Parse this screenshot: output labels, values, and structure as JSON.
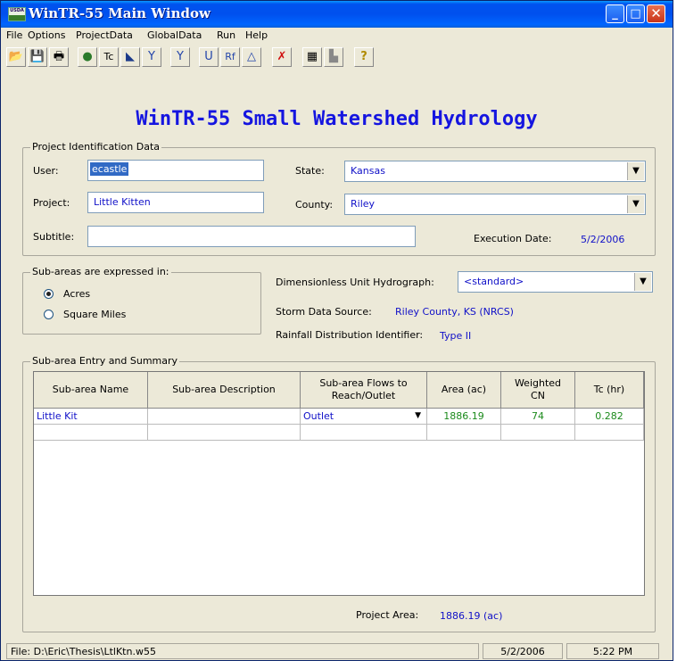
{
  "window": {
    "title": "WinTR-55 Main Window",
    "icon_label": "USDA",
    "minimize_glyph": "_",
    "maximize_glyph": "□",
    "close_glyph": "✕"
  },
  "menu": [
    "File",
    "Options",
    "ProjectData",
    "GlobalData",
    "Run",
    "Help"
  ],
  "toolbar": [
    {
      "name": "open-icon",
      "glyph": "📂"
    },
    {
      "name": "save-icon",
      "glyph": "💾"
    },
    {
      "name": "print-icon",
      "glyph": "🖶"
    },
    {
      "name": "globe-icon",
      "glyph": "●"
    },
    {
      "name": "tc-icon",
      "glyph": "Tc"
    },
    {
      "name": "watershed-icon",
      "glyph": "◣"
    },
    {
      "name": "reach-icon",
      "glyph": "Y"
    },
    {
      "name": "reach-flow-icon",
      "glyph": "Y"
    },
    {
      "name": "structure-icon",
      "glyph": "U"
    },
    {
      "name": "rf-icon",
      "glyph": "Rf"
    },
    {
      "name": "hydrograph-icon",
      "glyph": "△"
    },
    {
      "name": "run-icon",
      "glyph": "✗"
    },
    {
      "name": "table-icon",
      "glyph": "▦"
    },
    {
      "name": "graph-icon",
      "glyph": "▙"
    },
    {
      "name": "help-icon",
      "glyph": "?"
    }
  ],
  "heading": "WinTR-55 Small Watershed Hydrology",
  "project": {
    "group_title": "Project Identification Data",
    "user_label": "User:",
    "user_value": "ecastle",
    "state_label": "State:",
    "state_value": "Kansas",
    "project_label": "Project:",
    "project_value": "Little Kitten",
    "county_label": "County:",
    "county_value": "Riley",
    "subtitle_label": "Subtitle:",
    "subtitle_value": "",
    "exec_label": "Execution Date:",
    "exec_value": "5/2/2006"
  },
  "units": {
    "group_title": "Sub-areas are expressed in:",
    "acres": "Acres",
    "sq_miles": "Square Miles",
    "selected": "Acres"
  },
  "hydro": {
    "duh_label": "Dimensionless Unit Hydrograph:",
    "duh_value": "<standard>",
    "storm_label": "Storm Data Source:",
    "storm_value": "Riley County, KS  (NRCS)",
    "rain_label": "Rainfall Distribution Identifier:",
    "rain_value": "Type II"
  },
  "subarea": {
    "group_title": "Sub-area Entry and Summary",
    "headers": [
      "Sub-area Name",
      "Sub-area Description",
      "Sub-area Flows to\nReach/Outlet",
      "Area (ac)",
      "Weighted\nCN",
      "Tc (hr)"
    ],
    "rows": [
      {
        "name": "Little Kit",
        "desc": "",
        "flows": "Outlet",
        "area": "1886.19",
        "cn": "74",
        "tc": "0.282"
      }
    ],
    "project_area_label": "Project Area:",
    "project_area_value": "1886.19 (ac)"
  },
  "status": {
    "file": "File: D:\\Eric\\Thesis\\LtlKtn.w55",
    "date": "5/2/2006",
    "time": "5:22 PM"
  },
  "colors": {
    "title_bar": "#0053ee",
    "value_text": "#1010c8",
    "number_text": "#1b8a1b",
    "heading": "#1515e0"
  }
}
